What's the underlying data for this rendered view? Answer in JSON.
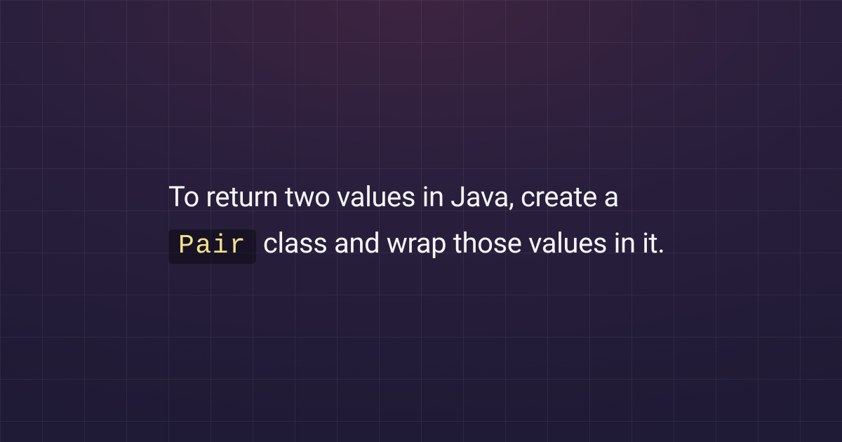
{
  "card": {
    "text_before": "To return two values in Java, create a ",
    "code": "Pair",
    "text_after": " class and wrap those values in it."
  }
}
